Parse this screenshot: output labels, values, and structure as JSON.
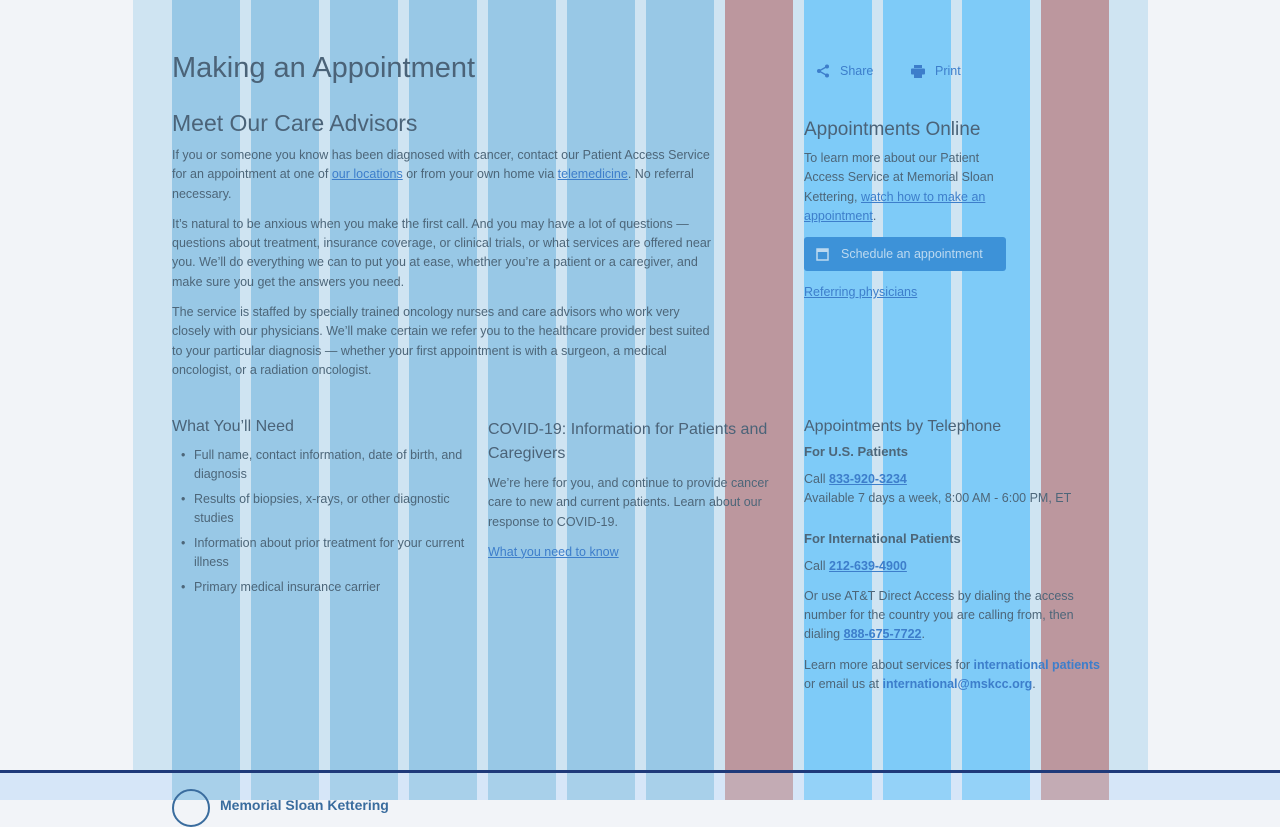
{
  "page": {
    "title": "Making an Appointment"
  },
  "toolbar": {
    "share": "Share",
    "print": "Print"
  },
  "main": {
    "heading": "Meet Our Care Advisors",
    "p1_a": "If you or someone you know has been diagnosed with cancer, contact our Patient Access Service for an appointment at one of ",
    "p1_link1": "our locations",
    "p1_b": " or from your own home via ",
    "p1_link2": "telemedicine",
    "p1_c": ". No referral necessary.",
    "p2": "It’s natural to be anxious when you make the first call. And you may have a lot of questions — questions about treatment, insurance coverage, or clinical trials, or what services are offered near you. We’ll do everything we can to put you at ease, whether you’re a patient or a caregiver, and make sure you get the answers you need.",
    "p3": "The service is staffed by specially trained oncology nurses and care advisors who work very closely with our physicians. We’ll make certain we refer you to the healthcare provider best suited to your particular diagnosis — whether your first appointment is with a surgeon, a medical oncologist, or a radiation oncologist."
  },
  "need": {
    "heading": "What You’ll Need",
    "items": [
      "Full name, contact information, date of birth, and diagnosis",
      "Results of biopsies, x-rays, or other diagnostic studies",
      "Information about prior treatment for your current illness",
      "Primary medical insurance carrier"
    ]
  },
  "covid": {
    "heading": "COVID-19: Information for Patients and Caregivers",
    "text": "We’re here for you, and continue to provide cancer care to new and current patients. Learn about our response to COVID-19.",
    "link": "What you need to know"
  },
  "online": {
    "heading": "Appointments Online",
    "text": "To learn more about our Patient Access Service at Memorial Sloan Kettering, ",
    "link": "watch how to make an appointment",
    "end": ".",
    "button": "Schedule an appointment",
    "referring": "Referring physicians"
  },
  "phone": {
    "heading": "Appointments by Telephone",
    "us_heading": "For U.S. Patients",
    "call": "Call ",
    "us_number": "833-920-3234",
    "hours": "Available 7 days a week, 8:00 AM - 6:00 PM, ET",
    "intl_heading": "For International Patients",
    "intl_number": "212-639-4900",
    "att_text": "Or use AT&T Direct Access by dialing the access number for the country you are calling from, then dialing ",
    "att_number": "888-675-7722",
    "period": ".",
    "learn_a": "Learn more about services for ",
    "learn_link": "international patients",
    "learn_b": " or email us at ",
    "email": "international@mskcc.org"
  },
  "footer": {
    "logo": "Memorial Sloan Kettering"
  },
  "colors": {
    "grid_column": "#98c8e6",
    "grid_column_highlight": "#7ecbf8",
    "grid_column_alt": "#bc979e",
    "footer_rule": "#1f3a7a",
    "link": "#3d7ecb"
  }
}
